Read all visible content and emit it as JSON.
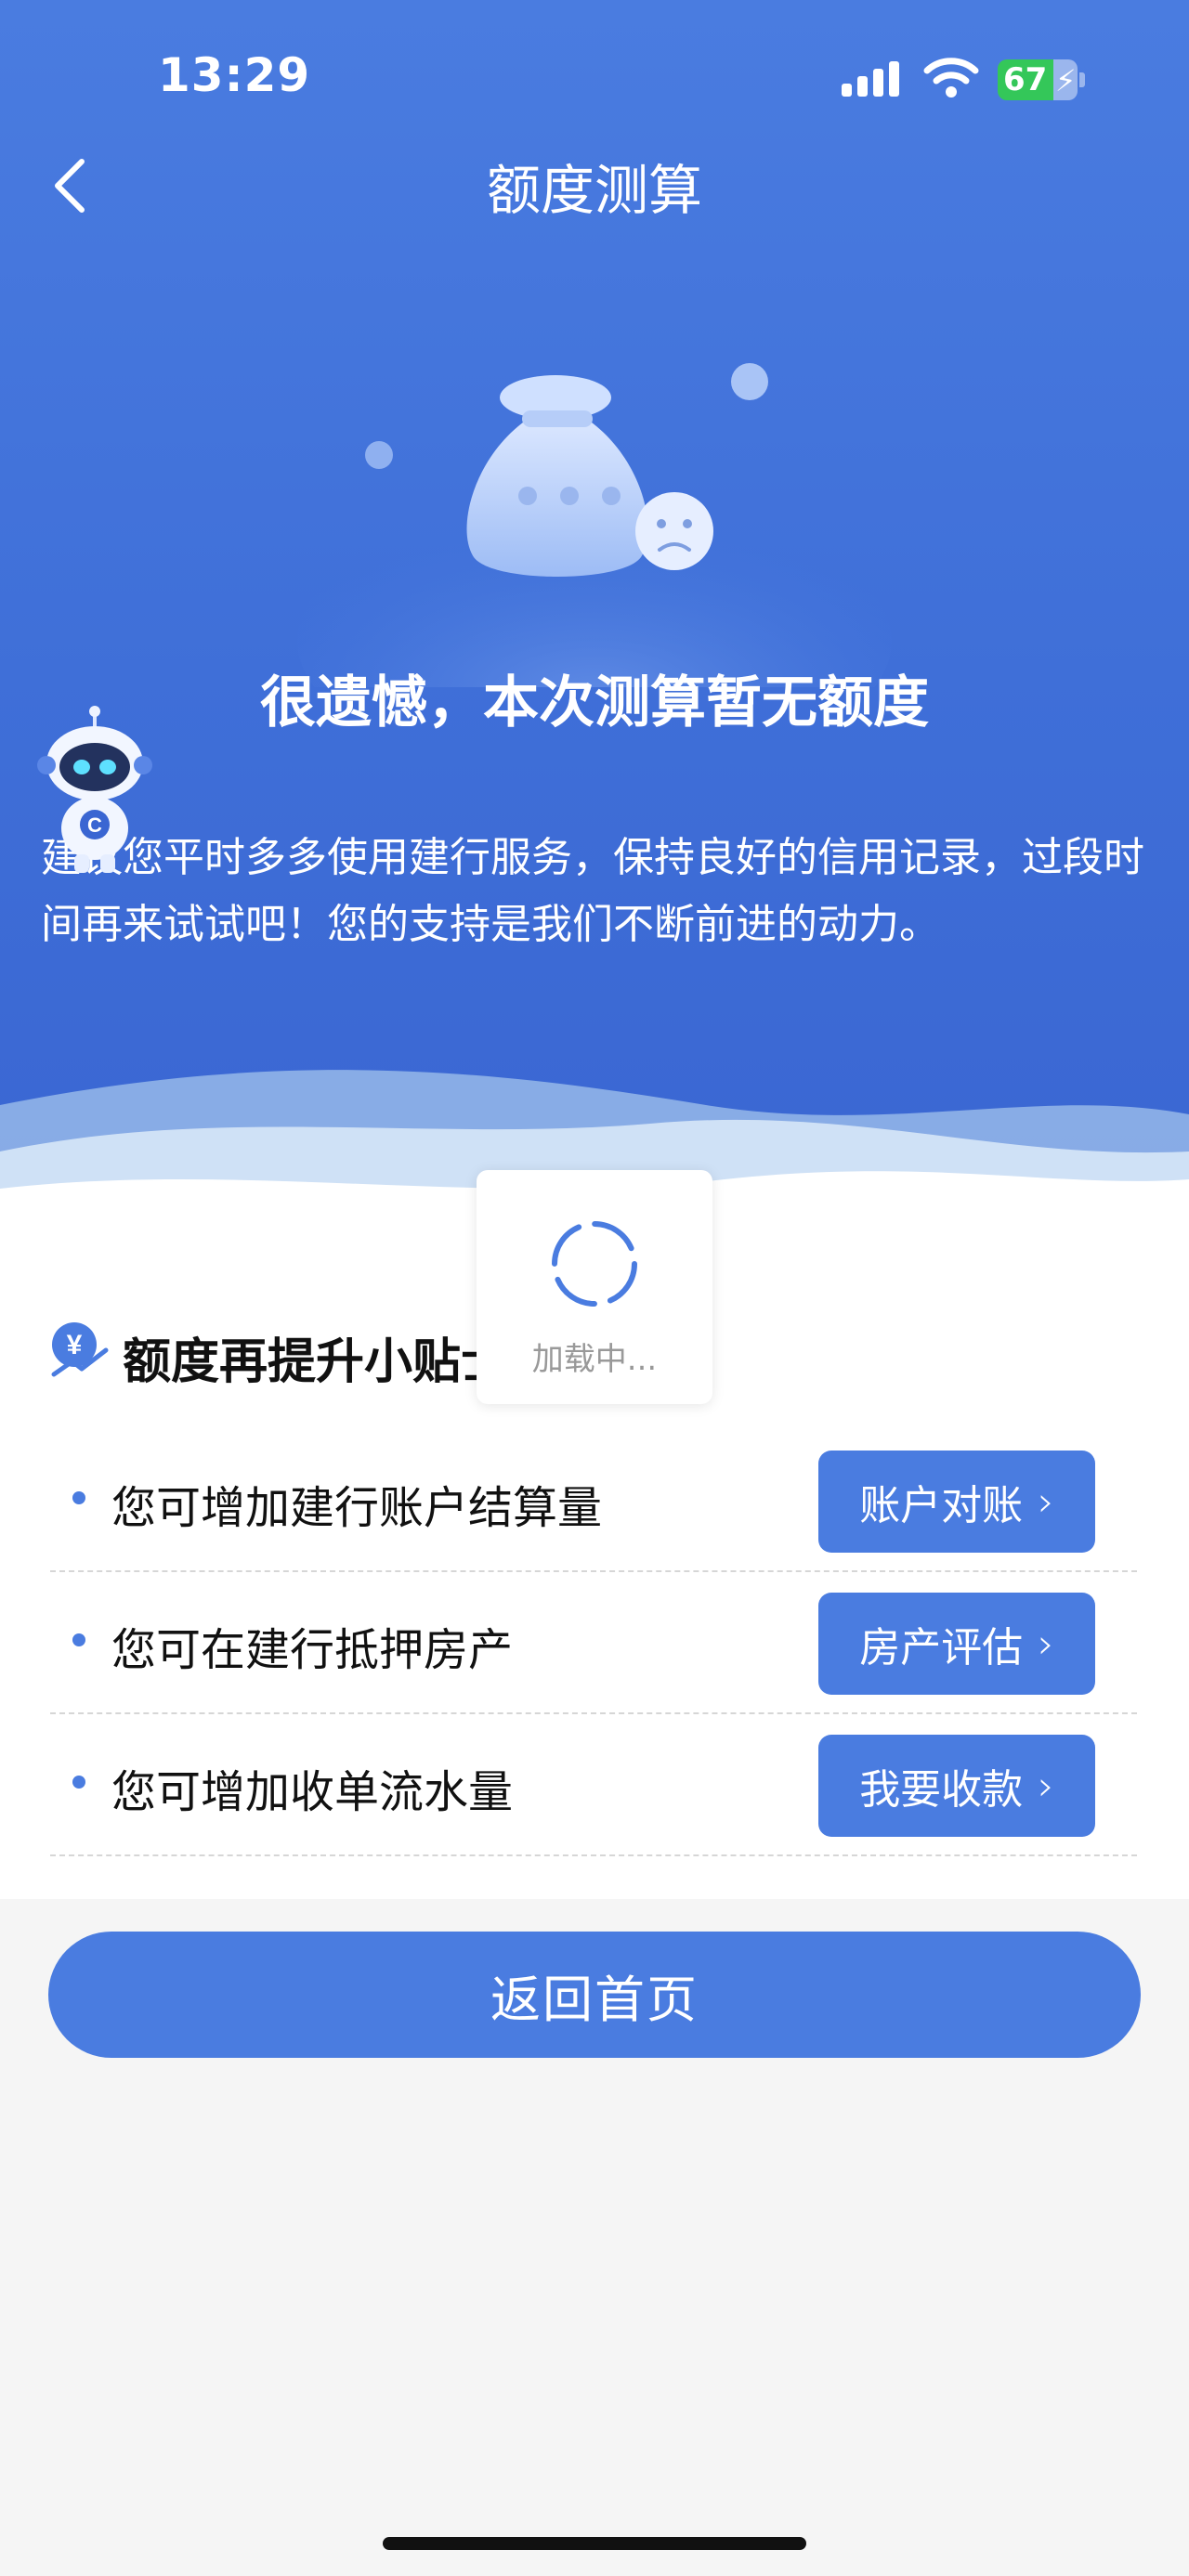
{
  "status_bar": {
    "time": "13:29",
    "battery": "67"
  },
  "nav": {
    "title": "额度测算",
    "back_icon": "chevron-left-icon"
  },
  "result": {
    "title": "很遗憾，本次测算暂无额度",
    "description": "建议您平时多多使用建行服务，保持良好的信用记录，过段时间再来试试吧！您的支持是我们不断前进的动力。"
  },
  "tips": {
    "title": "额度再提升小贴士",
    "items": [
      {
        "text": "您可增加建行账户结算量",
        "button": "账户对账"
      },
      {
        "text": "您可在建行抵押房产",
        "button": "房产评估"
      },
      {
        "text": "您可增加收单流水量",
        "button": "我要收款"
      }
    ]
  },
  "loading": {
    "text": "加载中..."
  },
  "home_button": "返回首页",
  "colors": {
    "primary": "#4a7ce0",
    "hero_bg": "#3f6fd8",
    "page_bg": "#f5f5f5"
  }
}
